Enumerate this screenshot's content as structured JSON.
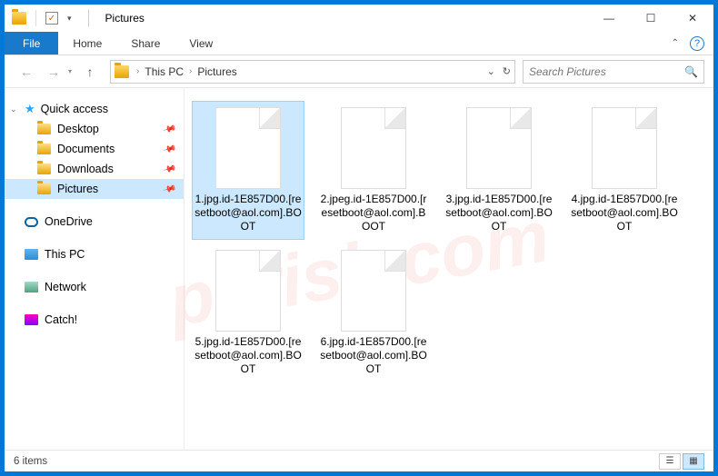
{
  "titlebar": {
    "title": "Pictures",
    "checkbox_mark": "✓"
  },
  "ribbon": {
    "file": "File",
    "home": "Home",
    "share": "Share",
    "view": "View"
  },
  "breadcrumb": {
    "root": "",
    "this_pc": "This PC",
    "folder": "Pictures"
  },
  "search": {
    "placeholder": "Search Pictures"
  },
  "sidebar": {
    "quick_access": "Quick access",
    "items": [
      {
        "label": "Desktop"
      },
      {
        "label": "Documents"
      },
      {
        "label": "Downloads"
      },
      {
        "label": "Pictures"
      }
    ],
    "onedrive": "OneDrive",
    "thispc": "This PC",
    "network": "Network",
    "catch": "Catch!"
  },
  "files": [
    {
      "name": "1.jpg.id-1E857D00.[resetboot@aol.com].BOOT",
      "selected": true
    },
    {
      "name": "2.jpeg.id-1E857D00.[resetboot@aol.com].BOOT",
      "selected": false
    },
    {
      "name": "3.jpg.id-1E857D00.[resetboot@aol.com].BOOT",
      "selected": false
    },
    {
      "name": "4.jpg.id-1E857D00.[resetboot@aol.com].BOOT",
      "selected": false
    },
    {
      "name": "5.jpg.id-1E857D00.[resetboot@aol.com].BOOT",
      "selected": false
    },
    {
      "name": "6.jpg.id-1E857D00.[resetboot@aol.com].BOOT",
      "selected": false
    }
  ],
  "status": {
    "count": "6 items"
  },
  "watermark": "pcrisk.com"
}
